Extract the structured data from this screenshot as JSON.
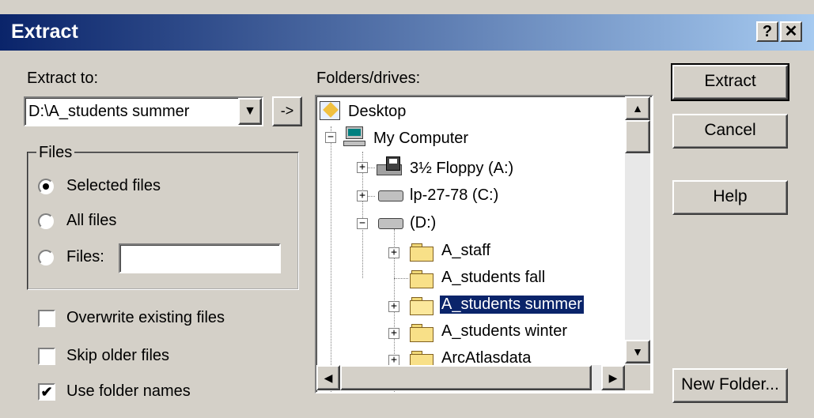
{
  "title": "Extract",
  "titlebar": {
    "help": "?",
    "close": "✕"
  },
  "extract_to": {
    "label": "Extract to:",
    "value": "D:\\A_students summer",
    "arrow_button": "->"
  },
  "files_group": {
    "label": "Files",
    "selected_files": "Selected files",
    "all_files": "All files",
    "files": "Files:",
    "files_value": ""
  },
  "options": {
    "overwrite": "Overwrite existing files",
    "skip_older": "Skip older files",
    "use_folder_names": "Use folder names",
    "use_folder_names_mark": "✔"
  },
  "folders": {
    "label": "Folders/drives:",
    "items": [
      {
        "label": "Desktop"
      },
      {
        "label": "My Computer"
      },
      {
        "label": "3½ Floppy (A:)"
      },
      {
        "label": "lp-27-78 (C:)"
      },
      {
        "label": "(D:)"
      },
      {
        "label": "A_staff"
      },
      {
        "label": "A_students fall"
      },
      {
        "label": "A_students summer"
      },
      {
        "label": "A_students winter"
      },
      {
        "label": "ArcAtlasdata"
      }
    ],
    "plus": "+",
    "minus": "−"
  },
  "buttons": {
    "extract": "Extract",
    "cancel": "Cancel",
    "help": "Help",
    "new_folder": "New Folder..."
  },
  "scroll": {
    "up": "▲",
    "down": "▼",
    "left": "◀",
    "right": "▶"
  }
}
